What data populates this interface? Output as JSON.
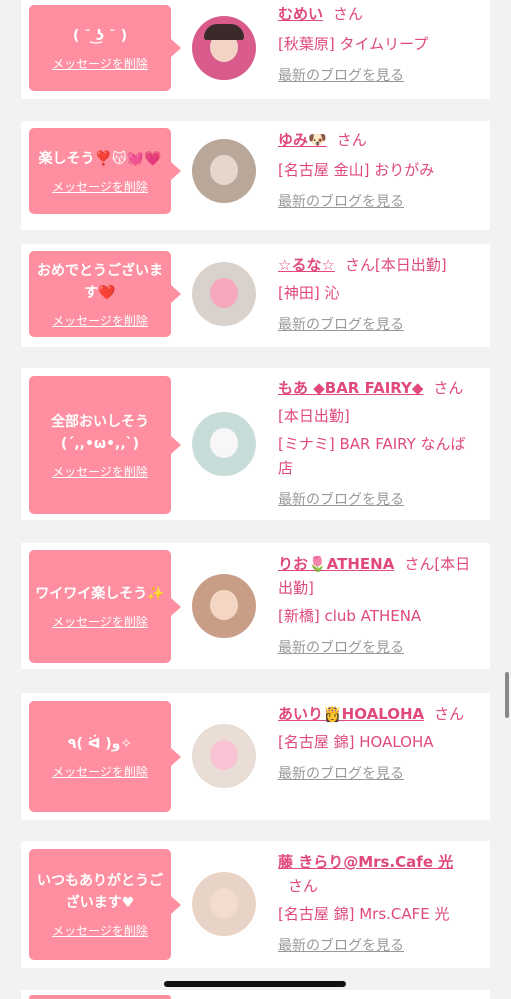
{
  "delete_label": "メッセージを削除",
  "blog_label": "最新のブログを見る",
  "san": "さん",
  "colors": {
    "bubble": "#ff8fa0",
    "accent": "#e0497a",
    "link_gray": "#999999",
    "background": "#f2f2f2"
  },
  "items": [
    {
      "message": "( ˘ ͜ʖ ˘ )",
      "name": "むめい",
      "shop": "[秋葉原] タイムリープ"
    },
    {
      "message": "楽しそう❣️😽💓💗",
      "name": "ゆみ🐶",
      "shop": "[名古屋 金山] おりがみ"
    },
    {
      "message": "おめでとうございます❤️",
      "name": "☆るな☆",
      "status": "[本日出勤]",
      "shop": "[神田] 沁"
    },
    {
      "message": "全部おいしそう(´,,•ω•,,`)",
      "name": "もあ ◆BAR FAIRY◆",
      "status": "[本日出勤]",
      "shop": "[ミナミ] BAR FAIRY なんば店"
    },
    {
      "message": "ワイワイ楽しそう✨",
      "name": "りお🌷ATHENA",
      "status": "[本日出勤]",
      "shop": "[新橋] club ATHENA"
    },
    {
      "message": "٩( ᐛ )و✧",
      "name": "あいり👸HOALOHA",
      "shop": "[名古屋 錦] HOALOHA"
    },
    {
      "message": "いつもありがとうございます♥",
      "name": "藤 きらり@Mrs.Cafe 光",
      "shop": "[名古屋 錦] Mrs.CAFE 光"
    }
  ]
}
